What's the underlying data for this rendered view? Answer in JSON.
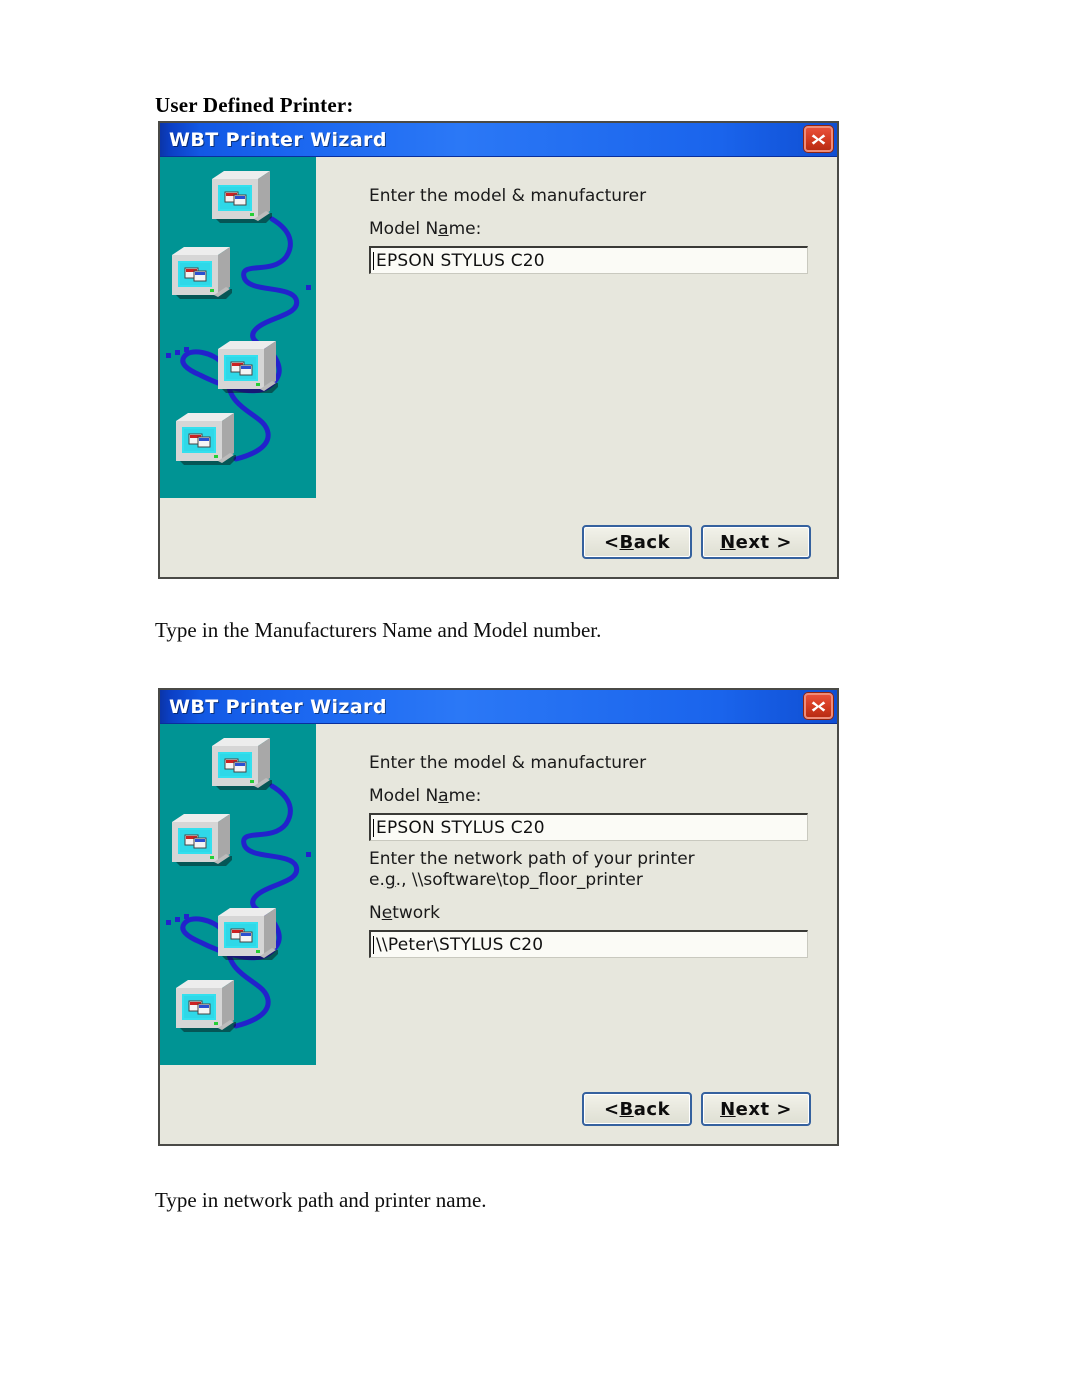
{
  "page": {
    "heading": "User Defined Printer:",
    "caption_1": "Type in the Manufacturers Name and Model number.",
    "caption_2": "Type in network path and printer name."
  },
  "colors": {
    "titlebar_blue": "#1a66f0",
    "illustration_teal": "#009494",
    "dialog_face": "#e7e7dd",
    "close_red": "#d23a20",
    "button_border_blue": "#35619e",
    "cable_blue": "#2222cc",
    "screen_cyan": "#33e0ee"
  },
  "dialog_1": {
    "title": "WBT Printer Wizard",
    "close_label": "Close",
    "prompt": "Enter the model & manufacturer",
    "model_label_pre": "Model N",
    "model_label_accel": "a",
    "model_label_post": "me:",
    "model_value": "EPSON STYLUS C20",
    "back_button": {
      "pre": "< ",
      "accel": "B",
      "post": "ack"
    },
    "next_button": {
      "pre": "",
      "accel": "N",
      "post": "ext >"
    }
  },
  "dialog_2": {
    "title": "WBT Printer Wizard",
    "close_label": "Close",
    "prompt": "Enter the model & manufacturer",
    "model_label_pre": "Model N",
    "model_label_accel": "a",
    "model_label_post": "me:",
    "model_value": "EPSON STYLUS C20",
    "network_prompt_line1": "Enter the network path of your printer",
    "network_prompt_line2_pre": "e.",
    "network_prompt_line2_accel": "g",
    "network_prompt_line2_post": "., \\\\software\\top_floor_printer",
    "network_label_pre": "N",
    "network_label_accel": "e",
    "network_label_post": "twork",
    "network_value": "\\\\Peter\\STYLUS C20",
    "back_button": {
      "pre": "< ",
      "accel": "B",
      "post": "ack"
    },
    "next_button": {
      "pre": "",
      "accel": "N",
      "post": "ext >"
    }
  },
  "illustration": {
    "name": "networked-computers-illustration",
    "monitor_count": 4,
    "description": "Four networked CRT computers connected by a blue zigzag cable on teal background"
  }
}
